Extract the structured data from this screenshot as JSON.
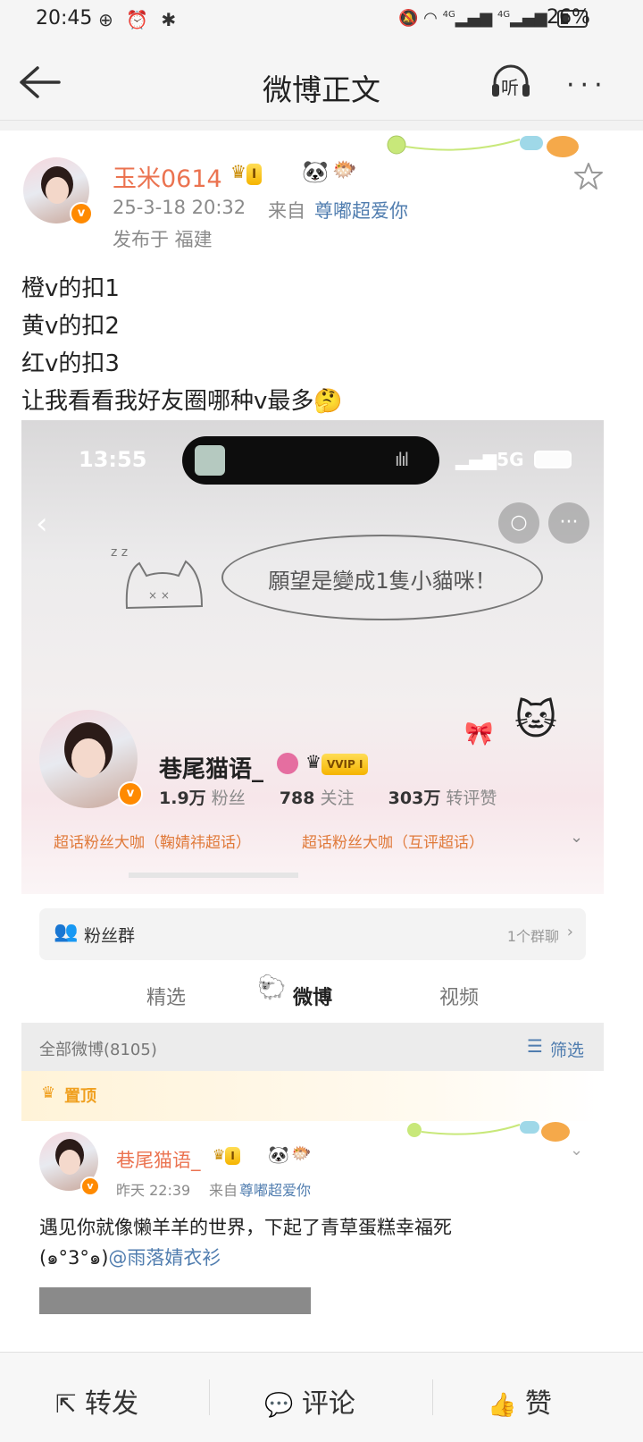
{
  "status_bar": {
    "time": "20:45",
    "battery": "26%",
    "network_a": "4G",
    "network_b": "4G"
  },
  "nav": {
    "title": "微博正文",
    "listen_label": "听"
  },
  "post": {
    "username": "玉米0614",
    "level_badge": "I",
    "time": "25-3-18 20:32",
    "from_prefix": "来自",
    "source": "尊嘟超爱你",
    "location": "发布于 福建",
    "lines": [
      "橙v的扣1",
      "黄v的扣2",
      "红v的扣3",
      "让我看看我好友圈哪种v最多"
    ]
  },
  "embedded": {
    "time": "13:55",
    "network": "5G",
    "bubble_text": "願望是變成1隻小貓咪！",
    "profile": {
      "name": "巷尾猫语_",
      "vip_badge": "VVIP I",
      "fans_num": "1.9万",
      "fans_label": "粉丝",
      "follow_num": "788",
      "follow_label": "关注",
      "likes_num": "303万",
      "likes_label": "转评赞",
      "supertag_1": "超话粉丝大咖（鞠婧祎超话）",
      "supertag_2": "超话粉丝大咖（互评超话）"
    },
    "fan_group": {
      "label": "粉丝群",
      "count": "1个群聊"
    },
    "tabs": [
      "精选",
      "微博",
      "视频"
    ],
    "all_weibo": "全部微博(8105)",
    "filter": "筛选",
    "pinned": "置顶",
    "sub_post": {
      "name": "巷尾猫语_",
      "level": "I",
      "time": "昨天 22:39",
      "from_prefix": "来自",
      "source": "尊嘟超爱你",
      "text_line1": "遇见你就像懒羊羊的世界，下起了青草蛋糕幸福死",
      "text_emoticon": "(๑°3°๑)",
      "mention": "@雨落婧衣衫"
    }
  },
  "bottom_bar": {
    "repost": "转发",
    "comment": "评论",
    "like": "赞"
  },
  "colors": {
    "accent_orange": "#eb7350",
    "link_blue": "#507daf",
    "verified_orange": "#ff8a00"
  }
}
